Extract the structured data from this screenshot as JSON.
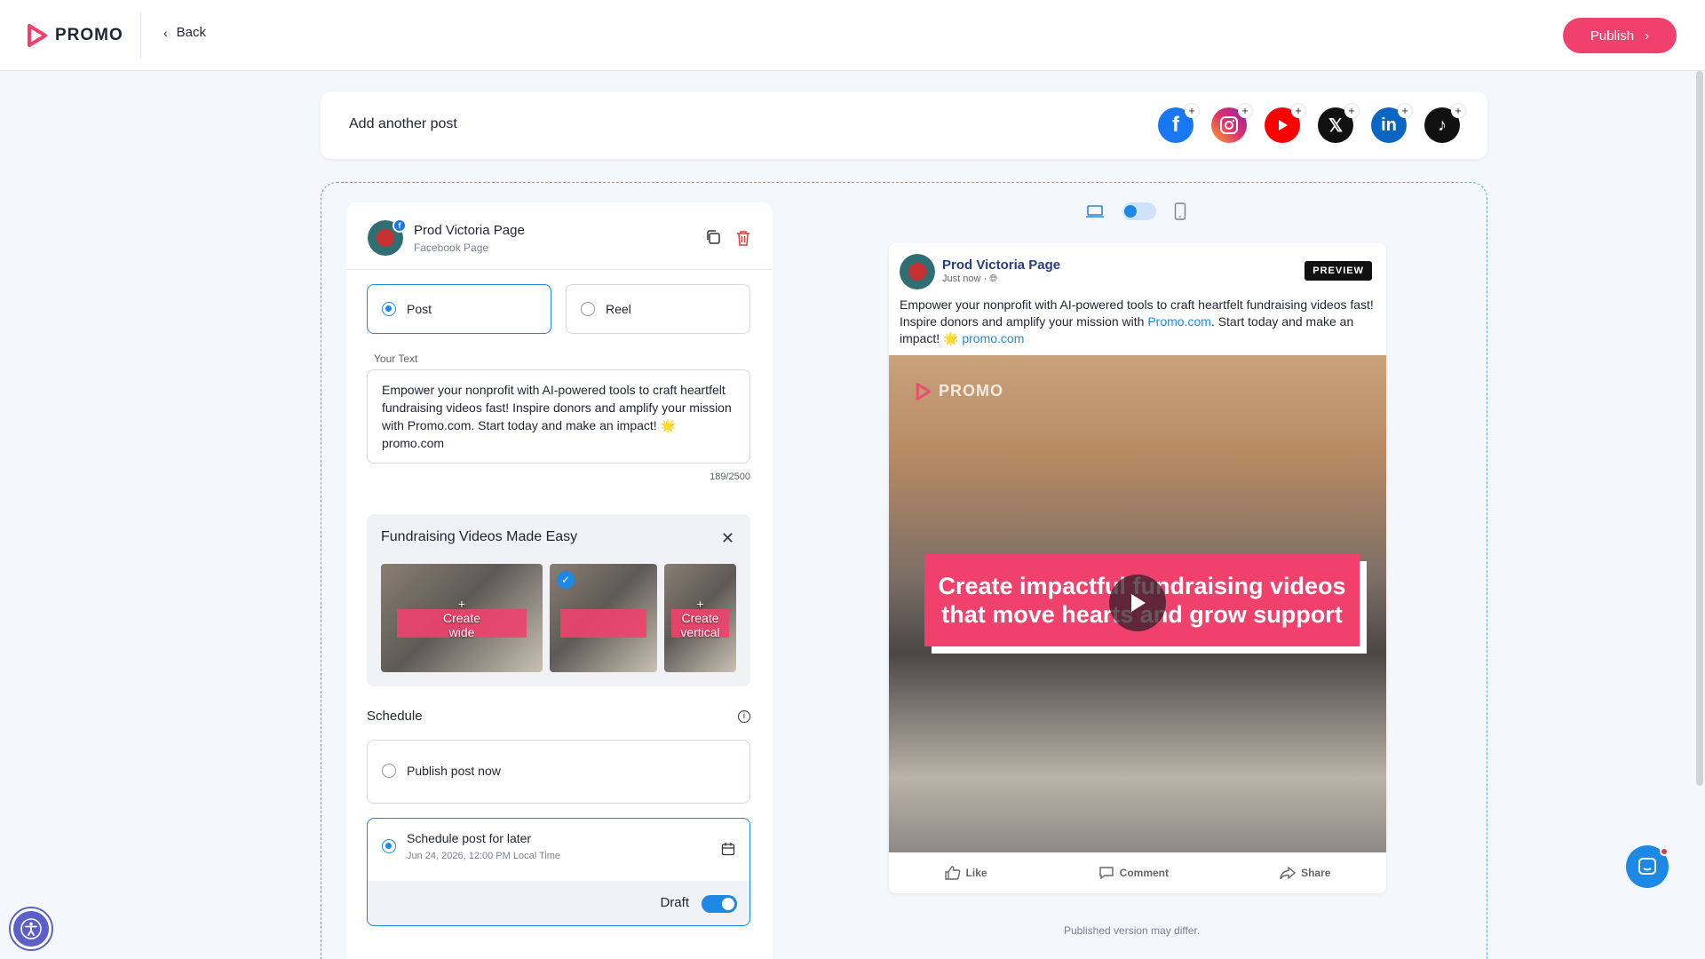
{
  "header": {
    "logo_text": "PROMO",
    "back_label": "Back",
    "publish_label": "Publish"
  },
  "add_post": {
    "title": "Add another post",
    "platforms": [
      {
        "name": "facebook-icon",
        "color": "#1877f2"
      },
      {
        "name": "instagram-icon",
        "color": "#e1306c"
      },
      {
        "name": "youtube-icon",
        "color": "#ff0000"
      },
      {
        "name": "x-icon",
        "color": "#111111"
      },
      {
        "name": "linkedin-icon",
        "color": "#0a66c2"
      },
      {
        "name": "tiktok-icon",
        "color": "#111111"
      }
    ]
  },
  "editor": {
    "account_name": "Prod Victoria Page",
    "account_type": "Facebook Page",
    "post_types": [
      {
        "label": "Post",
        "selected": true
      },
      {
        "label": "Reel",
        "selected": false
      }
    ],
    "text_label": "Your Text",
    "text_value": "Empower your nonprofit with AI-powered tools to craft heartfelt fundraising videos fast! Inspire donors and amplify your mission with Promo.com. Start today and make an impact! 🌟 promo.com",
    "char_count": "189/2500",
    "media": {
      "title": "Fundraising Videos Made Easy",
      "thumb_wide_line1": "Create",
      "thumb_wide_line2": "wide",
      "thumb_vertical_line1": "Create",
      "thumb_vertical_line2": "vertical",
      "selected_index": 1
    },
    "schedule": {
      "label": "Schedule",
      "option_now": "Publish post now",
      "option_later": "Schedule post for later",
      "later_datetime": "Jun 24, 2026, 12:00 PM Local Time",
      "selected": "later",
      "draft_label": "Draft",
      "draft_on": true
    }
  },
  "preview": {
    "page_name": "Prod Victoria Page",
    "time": "Just now",
    "badge": "PREVIEW",
    "text_part1": "Empower your nonprofit with AI-powered tools to craft heartfelt fundraising videos fast! Inspire donors and amplify your mission with ",
    "text_link1": "Promo.com",
    "text_part2": ". Start today and make an impact! 🌟 ",
    "text_link2": "promo.com",
    "video_logo": "PROMO",
    "video_line1": "Create impactful fundraising videos",
    "video_line2": "that move hearts and grow support",
    "like": "Like",
    "comment": "Comment",
    "share": "Share",
    "disclaimer": "Published version may differ."
  },
  "colors": {
    "accent": "#1e88e5",
    "brand": "#f0416c"
  }
}
